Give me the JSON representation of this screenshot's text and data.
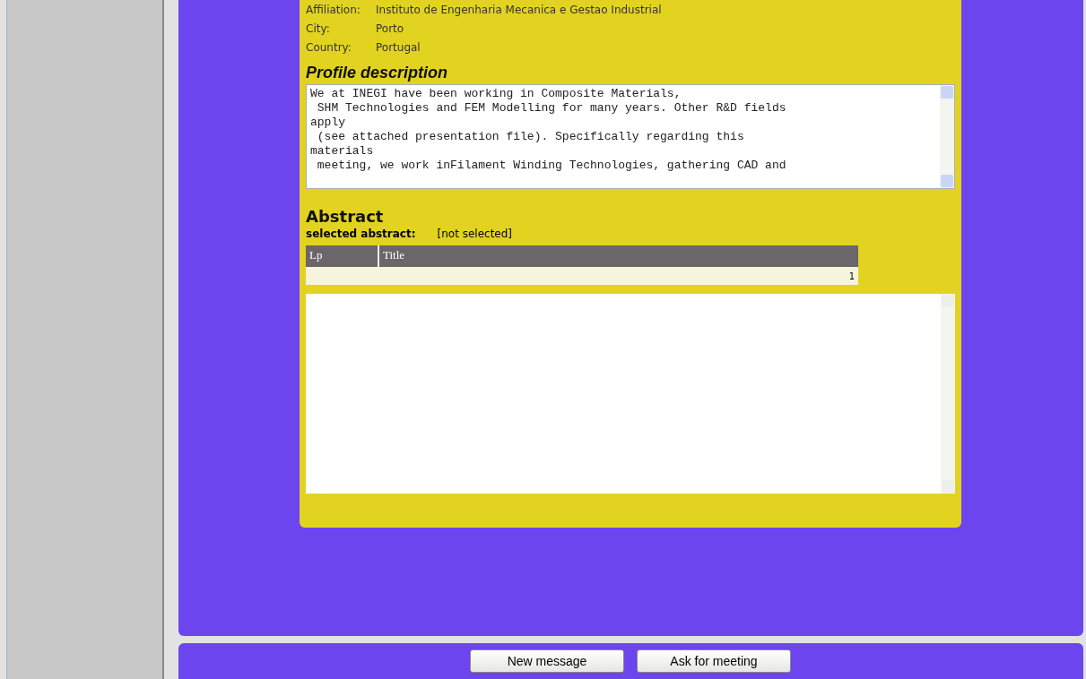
{
  "profile_fields": [
    {
      "label": "Affiliation:",
      "value": "Instituto de Engenharia Mecanica e Gestao Industrial"
    },
    {
      "label": "City:",
      "value": "Porto"
    },
    {
      "label": "Country:",
      "value": "Portugal"
    }
  ],
  "profile_description": {
    "title": "Profile description",
    "text": "We at INEGI have been working in Composite Materials,\n SHM Technologies and FEM Modelling for many years. Other R&D fields\napply\n (see attached presentation file). Specifically regarding this\nmaterials\n meeting, we work inFilament Winding Technologies, gathering CAD and"
  },
  "abstract": {
    "title": "Abstract",
    "selected_label": "selected abstract:",
    "selected_value": "[not selected]",
    "table": {
      "columns": [
        "Lp",
        "Title"
      ],
      "rows": [
        {
          "lp": "",
          "title": "1"
        }
      ]
    }
  },
  "buttons": [
    "New message",
    "Ask for meeting"
  ]
}
